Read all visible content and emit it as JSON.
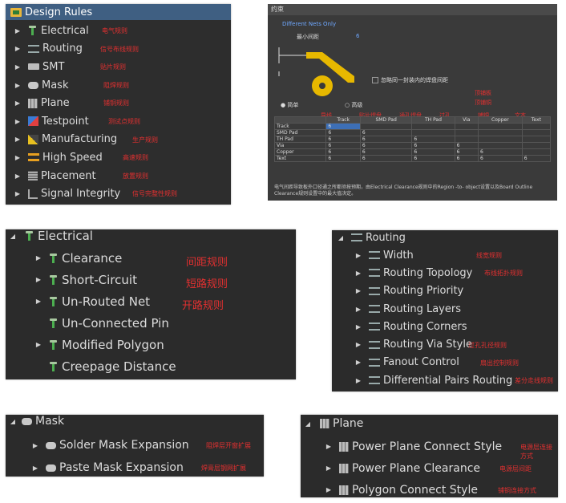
{
  "design_rules": {
    "title": "Design Rules",
    "items": [
      {
        "label": "Electrical",
        "note": "电气规则",
        "icon": "electrical-rule-icon"
      },
      {
        "label": "Routing",
        "note": "信号布线规则",
        "icon": "routing-rule-icon"
      },
      {
        "label": "SMT",
        "note": "贴片规则",
        "icon": "smt-rule-icon"
      },
      {
        "label": "Mask",
        "note": "阻焊规则",
        "icon": "mask-rule-icon"
      },
      {
        "label": "Plane",
        "note": "铺铜规则",
        "icon": "plane-rule-icon"
      },
      {
        "label": "Testpoint",
        "note": "测试点规则",
        "icon": "testpoint-rule-icon"
      },
      {
        "label": "Manufacturing",
        "note": "生产规则",
        "icon": "manufacturing-rule-icon"
      },
      {
        "label": "High Speed",
        "note": "高速规则",
        "icon": "high-speed-rule-icon"
      },
      {
        "label": "Placement",
        "note": "放置规则",
        "icon": "placement-rule-icon"
      },
      {
        "label": "Signal Integrity",
        "note": "信号完整性规则",
        "icon": "signal-integrity-rule-icon"
      }
    ]
  },
  "clearance_dialog": {
    "title": "约束",
    "different_nets_only": "Different Nets Only",
    "min_clearance_label": "最小间距",
    "min_clearance_value": "6",
    "ignore_checkbox": "忽略同一封装内的焊盘间距",
    "mode_simple": "简单",
    "mode_advanced": "高级",
    "col_notes": [
      "导线",
      "贴片焊盘",
      "通孔焊盘",
      "过孔",
      "铺铜",
      "文本"
    ],
    "extra_notes": [
      "顶铺板",
      "顶铺铜"
    ],
    "columns": [
      "Track",
      "SMD Pad",
      "TH Pad",
      "Via",
      "Copper",
      "Text"
    ],
    "rows": [
      {
        "name": "Track",
        "cells": [
          "6",
          "",
          "",
          "",
          "",
          ""
        ]
      },
      {
        "name": "SMD Pad",
        "cells": [
          "6",
          "6",
          "",
          "",
          "",
          ""
        ]
      },
      {
        "name": "TH Pad",
        "cells": [
          "6",
          "6",
          "6",
          "",
          "",
          ""
        ]
      },
      {
        "name": "Via",
        "cells": [
          "6",
          "6",
          "6",
          "6",
          "",
          ""
        ]
      },
      {
        "name": "Copper",
        "cells": [
          "6",
          "6",
          "6",
          "6",
          "6",
          ""
        ]
      },
      {
        "name": "Text",
        "cells": [
          "6",
          "6",
          "6",
          "6",
          "6",
          "6"
        ]
      }
    ],
    "footer": "电气间距导致板外口径通之所都须按预期，由Electrical Clearance规则中的Region -to- object设置以及Board Outline Clearance规则设置中的最大值决定。"
  },
  "electrical": {
    "title": "Electrical",
    "items": [
      {
        "label": "Clearance",
        "note": "间距规则",
        "expand": true
      },
      {
        "label": "Short-Circuit",
        "note": "短路规则",
        "expand": true
      },
      {
        "label": "Un-Routed Net",
        "note": "开路规则",
        "expand": true
      },
      {
        "label": "Un-Connected Pin",
        "note": "",
        "expand": false
      },
      {
        "label": "Modified Polygon",
        "note": "",
        "expand": true
      },
      {
        "label": "Creepage Distance",
        "note": "",
        "expand": false
      }
    ]
  },
  "routing": {
    "title": "Routing",
    "items": [
      {
        "label": "Width",
        "note": "线宽规则"
      },
      {
        "label": "Routing Topology",
        "note": "布线拓扑规则"
      },
      {
        "label": "Routing Priority",
        "note": ""
      },
      {
        "label": "Routing Layers",
        "note": ""
      },
      {
        "label": "Routing Corners",
        "note": ""
      },
      {
        "label": "Routing Via Style",
        "note": "过孔孔径规则"
      },
      {
        "label": "Fanout Control",
        "note": "扇出控制规则"
      },
      {
        "label": "Differential Pairs Routing",
        "note": "差分走线规则"
      }
    ]
  },
  "mask": {
    "title": "Mask",
    "items": [
      {
        "label": "Solder Mask Expansion",
        "note": "阻焊层开窗扩展"
      },
      {
        "label": "Paste Mask Expansion",
        "note": "焊膏层钢网扩展"
      }
    ]
  },
  "plane": {
    "title": "Plane",
    "items": [
      {
        "label": "Power Plane Connect Style",
        "note": "电源层连接方式"
      },
      {
        "label": "Power Plane Clearance",
        "note": "电源层间距"
      },
      {
        "label": "Polygon Connect Style",
        "note": "铺铜连接方式"
      }
    ]
  }
}
